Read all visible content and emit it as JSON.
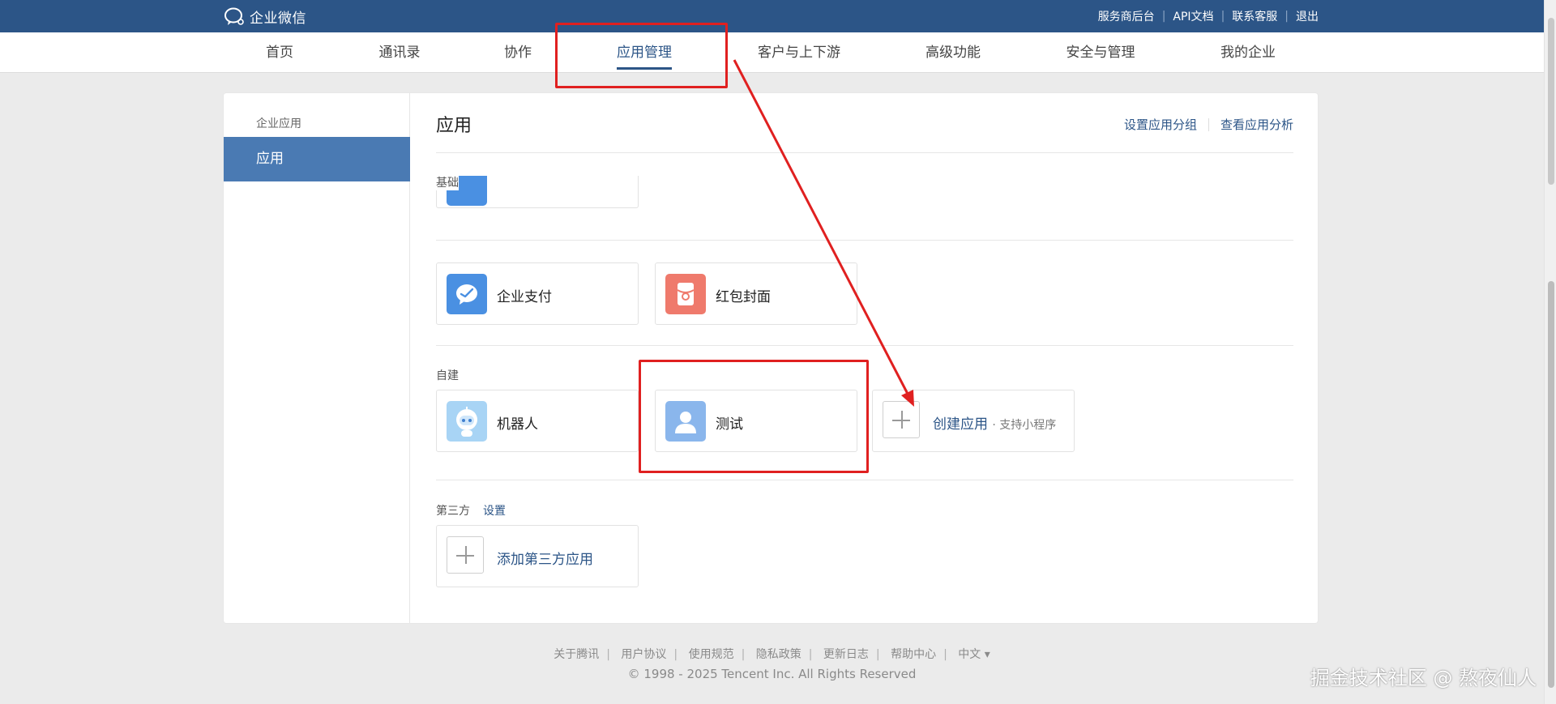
{
  "topbar": {
    "logo_text": "企业微信",
    "links": [
      "服务商后台",
      "API文档",
      "联系客服",
      "退出"
    ]
  },
  "nav": {
    "items": [
      "首页",
      "通讯录",
      "协作",
      "应用管理",
      "客户与上下游",
      "高级功能",
      "安全与管理",
      "我的企业"
    ],
    "active_index": 3
  },
  "sidebar": {
    "heading": "企业应用",
    "items": [
      {
        "label": "应用",
        "selected": true
      }
    ]
  },
  "main": {
    "title": "应用",
    "actions": [
      "设置应用分组",
      "查看应用分析"
    ],
    "sections": {
      "basic": {
        "label": "基础"
      },
      "payment": {
        "apps": [
          {
            "name": "企业支付",
            "icon": "payment-icon",
            "color": "#4a90e2"
          },
          {
            "name": "红包封面",
            "icon": "red-packet-icon",
            "color": "#ef7a6c"
          }
        ]
      },
      "custom": {
        "label": "自建",
        "apps": [
          {
            "name": "机器人",
            "icon": "robot-icon",
            "color": "#a8d4f5"
          },
          {
            "name": "测试",
            "icon": "user-icon",
            "color": "#8ab6ec"
          }
        ],
        "create": {
          "label": "创建应用",
          "sub": "· 支持小程序"
        }
      },
      "third_party": {
        "label": "第三方",
        "settings_link": "设置",
        "add_label": "添加第三方应用"
      }
    }
  },
  "footer": {
    "links": [
      "关于腾讯",
      "用户协议",
      "使用规范",
      "隐私政策",
      "更新日志",
      "帮助中心",
      "中文 ▾"
    ],
    "copyright": "© 1998 - 2025 Tencent Inc. All Rights Reserved"
  },
  "watermark": "掘金技术社区 @ 熬夜仙人",
  "colors": {
    "brand": "#2c5587",
    "sidebar_selected": "#4a7ab3",
    "annotation": "#e02020"
  }
}
